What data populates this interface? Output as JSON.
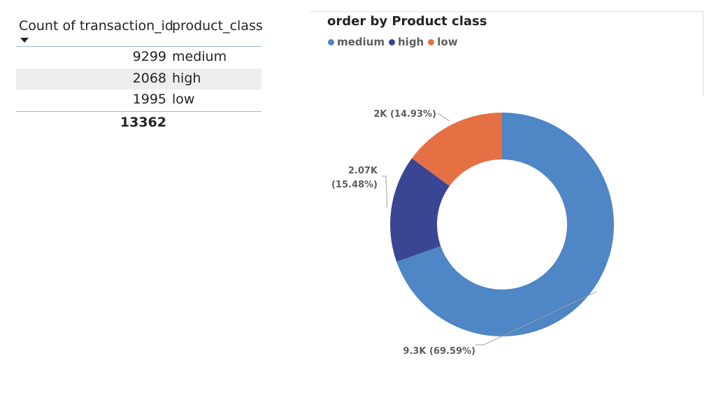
{
  "table": {
    "headers": {
      "count": "Count of transaction_id",
      "class": "product_class"
    },
    "rows": [
      {
        "count": "9299",
        "class": "medium"
      },
      {
        "count": "2068",
        "class": "high"
      },
      {
        "count": "1995",
        "class": "low"
      }
    ],
    "total": "13362"
  },
  "chart_data": {
    "type": "pie",
    "title": "order by Product class",
    "categories": [
      "medium",
      "high",
      "low"
    ],
    "values": [
      9299,
      2068,
      1995
    ],
    "labels": [
      "9.3K (69.59%)",
      "2.07K (15.48%)",
      "2K (14.93%)"
    ],
    "colors": [
      "#4e86c6",
      "#3a4694",
      "#e57044"
    ],
    "legend_position": "top-left",
    "donut": true
  }
}
